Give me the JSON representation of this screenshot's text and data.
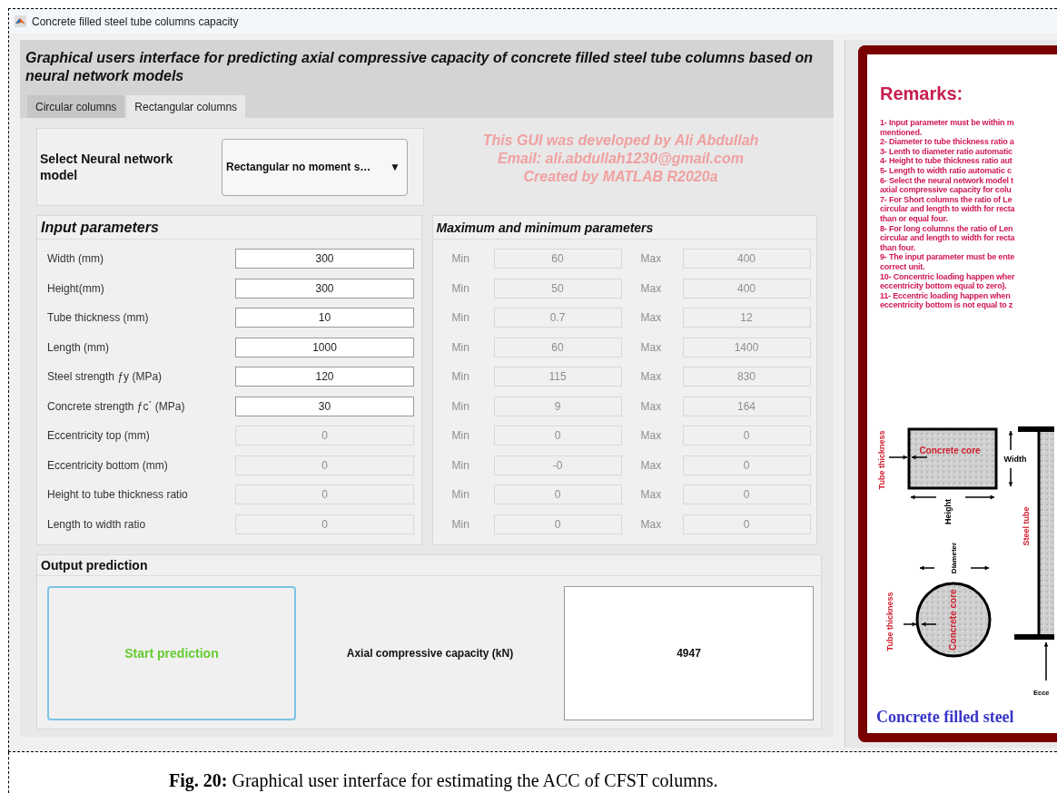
{
  "window": {
    "title": "Concrete filled steel tube columns capacity"
  },
  "header": {
    "title": "Graphical users interface for predicting axial compressive capacity of concrete filled steel tube columns based on neural network models"
  },
  "tabs": [
    {
      "label": "Circular columns",
      "selected": false
    },
    {
      "label": "Rectangular columns",
      "selected": true
    }
  ],
  "model_select": {
    "label": "Select Neural network model",
    "value": "Rectangular no moment s…",
    "caret": "▼"
  },
  "credits": [
    "This GUI was developed by Ali Abdullah",
    "Email: ali.abdullah1230@gmail.com",
    "Created by MATLAB R2020a"
  ],
  "input_panel": {
    "title": "Input parameters",
    "rows": [
      {
        "label": "Width (mm)",
        "value": "300",
        "disabled": false
      },
      {
        "label": "Height(mm)",
        "value": "300",
        "disabled": false
      },
      {
        "label": "Tube thickness (mm)",
        "value": "10",
        "disabled": false
      },
      {
        "label": "Length (mm)",
        "value": "1000",
        "disabled": false
      },
      {
        "label": "Steel strength ƒy (MPa)",
        "value": "120",
        "disabled": false
      },
      {
        "label": "Concrete strength ƒc´ (MPa)",
        "value": "30",
        "disabled": false
      },
      {
        "label": "Eccentricity top (mm)",
        "value": "0",
        "disabled": true
      },
      {
        "label": "Eccentricity bottom (mm)",
        "value": "0",
        "disabled": true
      },
      {
        "label": "Height to tube thickness ratio",
        "value": "0",
        "disabled": true
      },
      {
        "label": "Length to width ratio",
        "value": "0",
        "disabled": true
      }
    ]
  },
  "range_panel": {
    "title": "Maximum and minimum parameters",
    "rows": [
      {
        "min_label": "Min",
        "min": "60",
        "max_label": "Max",
        "max": "400"
      },
      {
        "min_label": "Min",
        "min": "50",
        "max_label": "Max",
        "max": "400"
      },
      {
        "min_label": "Min",
        "min": "0.7",
        "max_label": "Max",
        "max": "12"
      },
      {
        "min_label": "Min",
        "min": "60",
        "max_label": "Max",
        "max": "1400"
      },
      {
        "min_label": "Min",
        "min": "115",
        "max_label": "Max",
        "max": "830"
      },
      {
        "min_label": "Min",
        "min": "9",
        "max_label": "Max",
        "max": "164"
      },
      {
        "min_label": "Min",
        "min": "0",
        "max_label": "Max",
        "max": "0"
      },
      {
        "min_label": "Min",
        "min": "-0",
        "max_label": "Max",
        "max": "0"
      },
      {
        "min_label": "Min",
        "min": "0",
        "max_label": "Max",
        "max": "0"
      },
      {
        "min_label": "Min",
        "min": "0",
        "max_label": "Max",
        "max": "0"
      }
    ]
  },
  "output_panel": {
    "title": "Output prediction",
    "button": "Start prediction",
    "result_label": "Axial compressive capacity (kN)",
    "result": "4947"
  },
  "remarks": {
    "title": "Remarks:",
    "lines": [
      "1- Input parameter must be within m",
      "mentioned.",
      "2- Diameter to tube thickness ratio a",
      "3- Lenth to diameter ratio automatic",
      "4- Height to tube thickness ratio aut",
      "5- Length to width ratio automatic c",
      "6- Select the neural network model t",
      "axial compressive capacity for colu",
      "7- For Short columns the ratio of Le",
      "circular and length to width for recta",
      "than or equal four.",
      "8- For long columns the ratio of Len",
      "circular and length to width for recta",
      "than four.",
      "9- The input parameter must be ente",
      "correct unit.",
      "10- Concentric loading happen wher",
      "eccentricity bottom equal to zero).",
      "11- Eccentric loading happen when",
      "eccentricity bottom is not equal to z"
    ],
    "diagram": {
      "rect_thickness_label": "Tube thickness",
      "rect_core_label": "Concrete core",
      "width_label": "Width",
      "height_label": "Height",
      "tube_label": "Steel tube",
      "diameter_label": "Diameter",
      "circle_thickness_label": "Tube thickness",
      "circle_core_label": "Concrete core",
      "eccentricity_label": "Ecce",
      "banner": "Concrete filled steel"
    }
  },
  "caption": "**Fig. 20:** Graphical user interface for estimating the ACC of CFST columns."
}
